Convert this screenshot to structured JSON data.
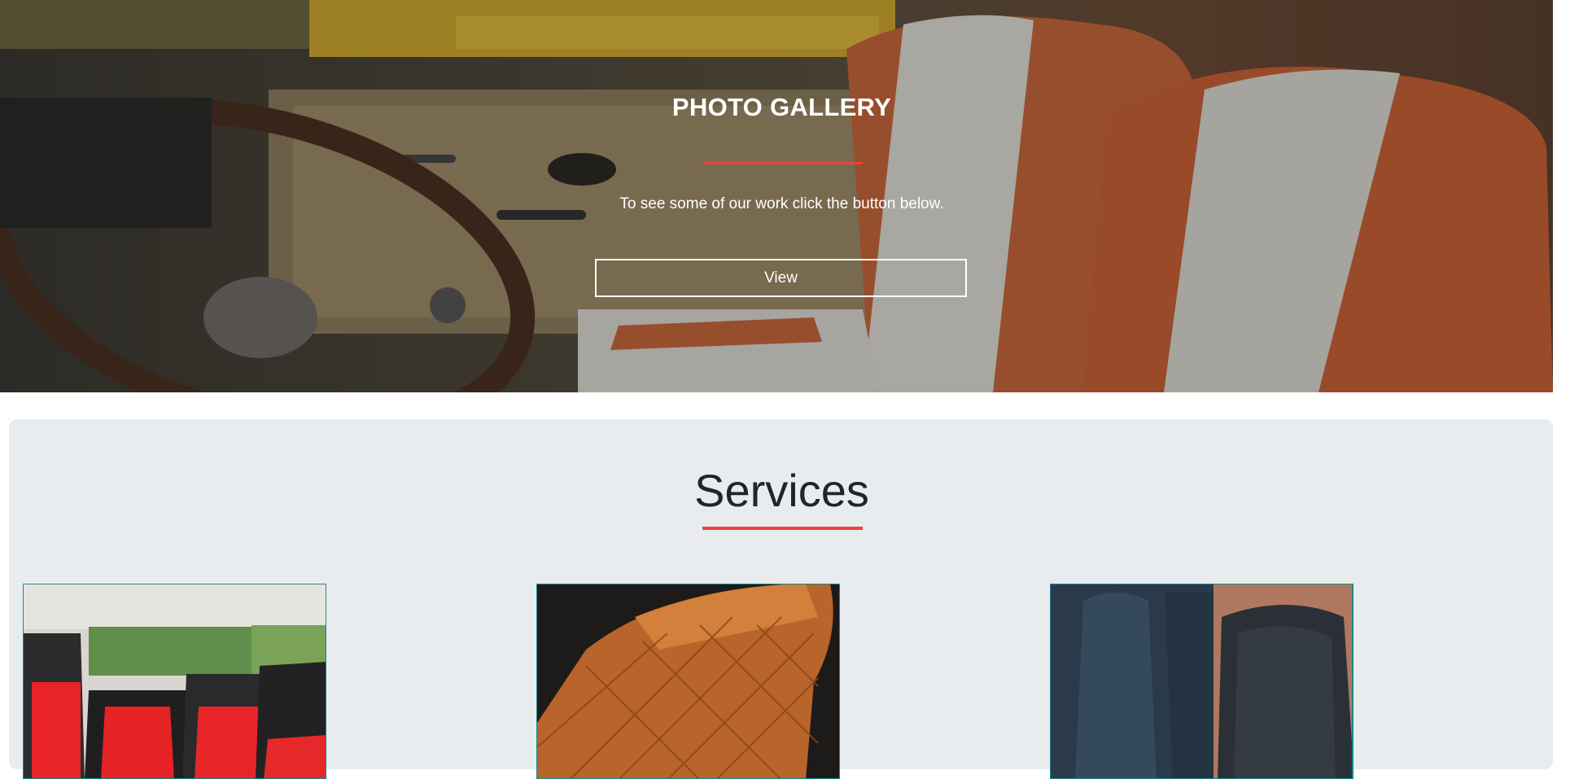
{
  "hero": {
    "title": "PHOTO GALLERY",
    "text": "To see some of our work click the button below.",
    "button_label": "View",
    "accent_color": "#e8453c"
  },
  "services": {
    "title": "Services",
    "cards": [
      {
        "image": "van-interior-red-black-seats-photo"
      },
      {
        "image": "tan-leather-diamond-stitch-seat-photo"
      },
      {
        "image": "black-vinyl-seat-cover-repair-photo"
      }
    ]
  }
}
